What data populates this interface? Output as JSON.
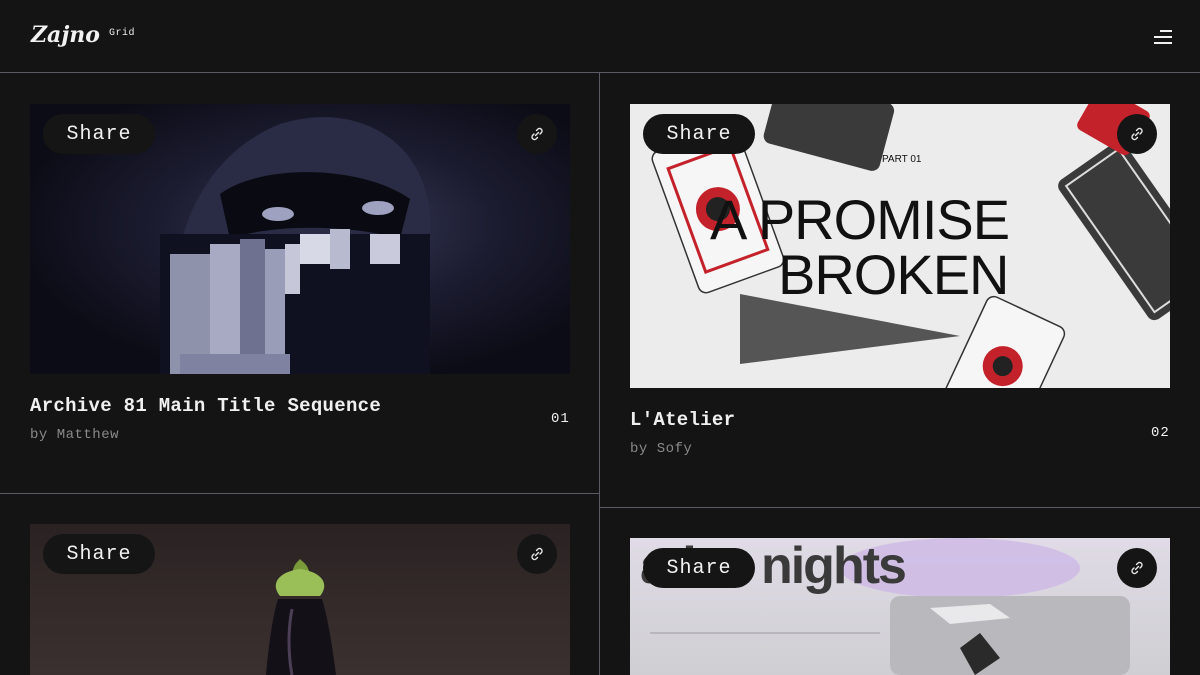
{
  "header": {
    "logo_text": "Zajno",
    "logo_sub": "Grid"
  },
  "cards": [
    {
      "title": "Archive 81 Main Title Sequence",
      "author": "by Matthew",
      "number": "01",
      "share_label": "Share"
    },
    {
      "title": "L'Atelier",
      "author": "by Sofy",
      "number": "02",
      "share_label": "Share",
      "image_text": {
        "part": "PART 01",
        "line1": "A PROMISE",
        "line2": "BROKEN"
      }
    },
    {
      "title": "",
      "author": "",
      "number": "",
      "share_label": "Share"
    },
    {
      "title": "",
      "author": "",
      "number": "",
      "share_label": "Share",
      "image_text": {
        "headline": "ative nights"
      }
    }
  ],
  "colors": {
    "background": "#141414",
    "divider": "#5a5a66",
    "text": "#f0f0f0",
    "muted": "#8a8a8a"
  }
}
